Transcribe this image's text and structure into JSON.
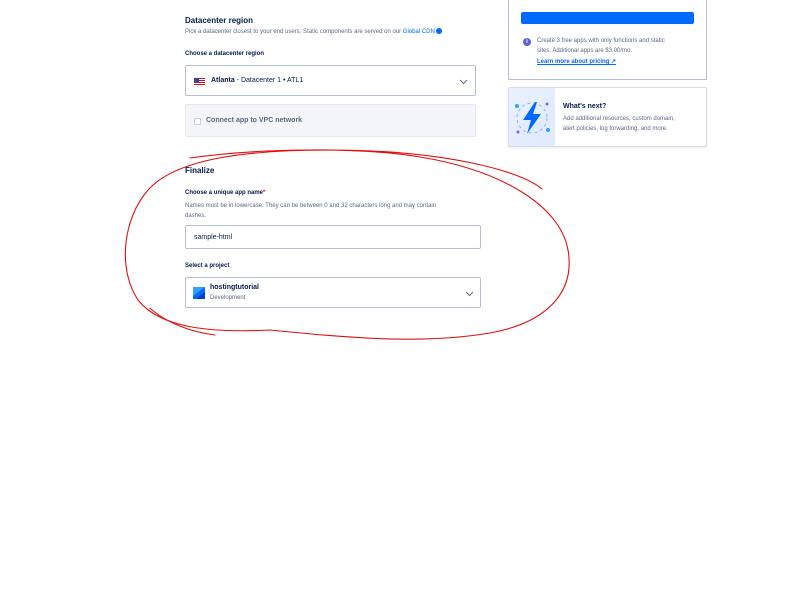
{
  "datacenter": {
    "title": "Datacenter region",
    "description": "Pick a datacenter closest to your end users. Static components are served on our",
    "cdn_link": "Global CDN",
    "choose_label": "Choose a datacenter region",
    "region_city": "Atlanta",
    "region_detail": " - Datacenter 1 • ATL1",
    "vpc_label": "Connect app to VPC network"
  },
  "finalize": {
    "title": "Finalize",
    "name_label": "Choose a unique app name",
    "name_required_mark": "*",
    "name_help_line1": "Names must be in lowercase. They can be between 0 and 32 characters long and may contain",
    "name_help_line2": "dashes.",
    "name_value": "sample-html",
    "project_label": "Select a project",
    "project_name": "hostingtutorial",
    "project_env": "Development"
  },
  "pricing_card": {
    "line1": "Create 3 free apps with only functions and static",
    "line2": "sites. Additional apps are $3.00/mo.",
    "link": "Learn more about pricing ↗"
  },
  "next_card": {
    "title": "What's next?",
    "line1": "Add additional resources, custom domain,",
    "line2": "alert policies, log forwarding, and more."
  },
  "colors": {
    "accent": "#0069ff",
    "text_primary": "#031b4e",
    "text_secondary": "#5b6987",
    "annotation": "#e01010"
  },
  "icons": {
    "flag": "us-flag-icon",
    "chevron": "chevron-down-icon",
    "info": "info-icon",
    "project": "project-icon",
    "whats_next": "lightning-illustration"
  }
}
